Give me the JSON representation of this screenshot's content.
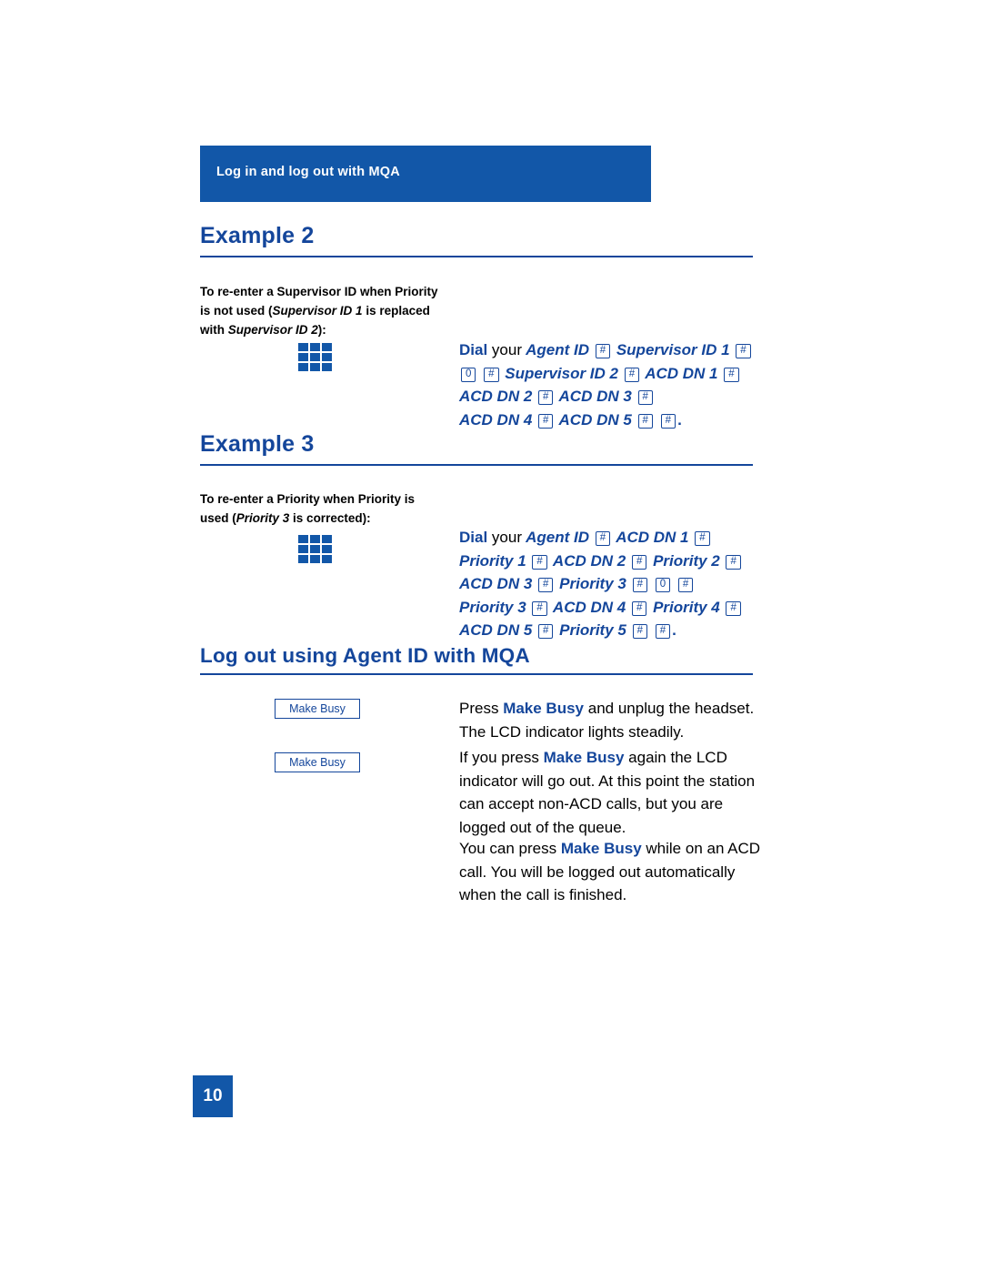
{
  "banner": {
    "title": "Log in and log out with MQA"
  },
  "sections": [
    {
      "heading": "Example 2",
      "description_html": "To re-enter a Supervisor ID when Priority is not used (<i>Supervisor ID 1</i> is replaced with <i>Supervisor ID 2</i>):",
      "instruction_lines_html": [
        "<span class='dial'>Dial</span> <span class='plain'>your</span> Agent ID <span class='key'>#</span> Supervisor ID 1 <span class='key'>#</span>",
        "<span class='key'>0</span> <span class='key'>#</span> Supervisor ID 2 <span class='key'>#</span> ACD DN 1 <span class='key'>#</span>",
        "ACD DN 2 <span class='key'>#</span> ACD DN 3 <span class='key'>#</span>",
        "ACD DN 4 <span class='key'>#</span> ACD DN 5 <span class='key'>#</span> <span class='key'>#</span><span class='period'>.</span>"
      ]
    },
    {
      "heading": "Example 3",
      "description_html": "To re-enter a Priority when Priority is used (<i>Priority 3</i> is corrected):",
      "instruction_lines_html": [
        "<span class='dial'>Dial</span> <span class='plain'>your</span> Agent ID <span class='key'>#</span> ACD DN 1 <span class='key'>#</span>",
        "Priority 1 <span class='key'>#</span> ACD DN 2 <span class='key'>#</span> Priority 2 <span class='key'>#</span>",
        "ACD DN 3 <span class='key'>#</span> Priority 3 <span class='key'>#</span> <span class='key'>0</span> <span class='key'>#</span>",
        "Priority 3 <span class='key'>#</span> ACD DN 4 <span class='key'>#</span> Priority 4 <span class='key'>#</span>",
        "ACD DN 5 <span class='key'>#</span> Priority 5 <span class='key'>#</span> <span class='key'>#</span><span class='period'>.</span>"
      ]
    }
  ],
  "logout_section": {
    "heading": "Log out using Agent ID with MQA",
    "softkeys": [
      {
        "label": "Make Busy"
      },
      {
        "label": "Make Busy"
      }
    ],
    "paragraphs_html": [
      "Press <b>Make Busy</b> and unplug the headset. The LCD indicator lights steadily.",
      "If you press <b>Make Busy</b> again the LCD indicator will go out. At this point the station can accept non-ACD calls, but you are logged out of the queue.",
      "You can press <b>Make Busy</b> while on an ACD call. You will be logged out automatically when the call is finished."
    ]
  },
  "page_number": "10",
  "colors": {
    "brand_blue": "#1257a8",
    "heading_blue": "#14469b",
    "white": "#ffffff"
  }
}
